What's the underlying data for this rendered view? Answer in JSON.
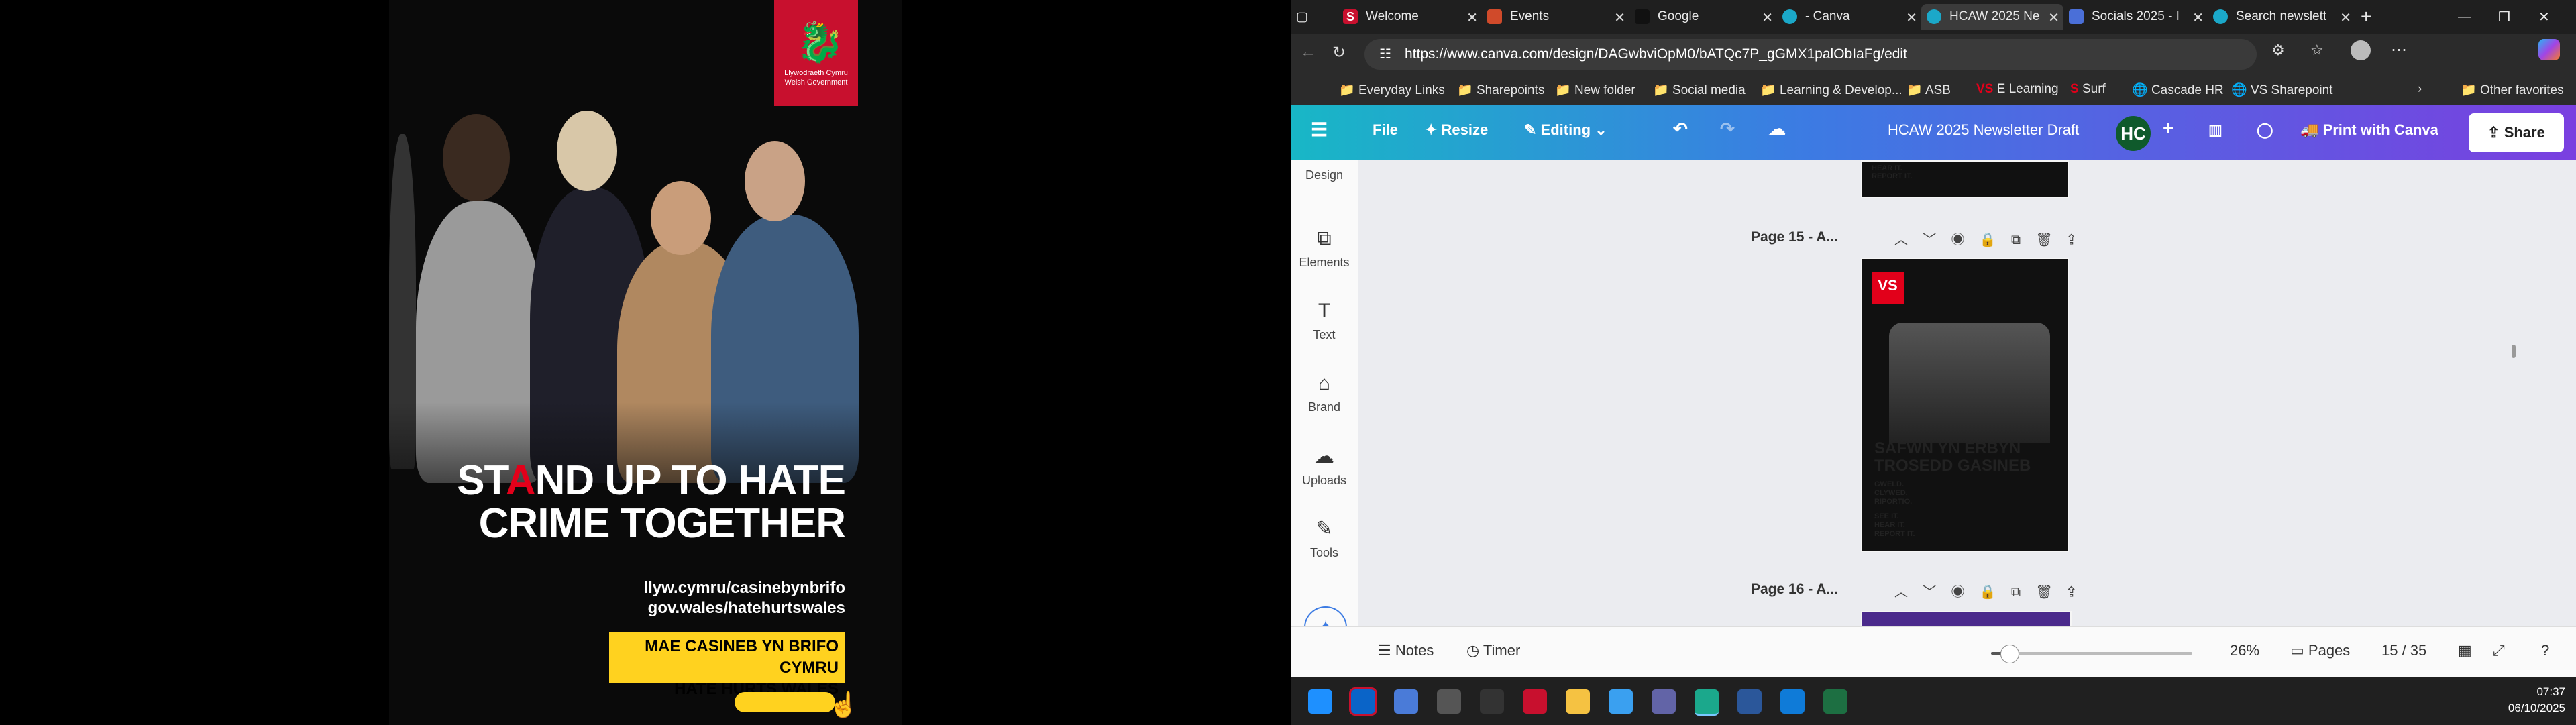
{
  "poster": {
    "logo_text": "Llywodraeth Cymru\nWelsh Government",
    "headline_line1_pre": "ST",
    "headline_line1_mark": "A",
    "headline_line1_post": "ND UP TO HATE",
    "headline_line2": "CRIME TOGETHER",
    "url1": "llyw.cymru/casinebynbrifo",
    "url2": "gov.wales/hatehurtswales",
    "yellow_line1": "MAE CASINEB YN BRIFO CYMRU",
    "yellow_line2": "HATE HURTS WALES"
  },
  "tabs": [
    {
      "label": "Welcome",
      "color": "#c8102e",
      "letter": "S"
    },
    {
      "label": "Events",
      "color": "#d04a2a",
      "letter": ""
    },
    {
      "label": "Google",
      "color": "#ffffff",
      "letter": "G"
    },
    {
      "label": "- Canva",
      "color": "#1ba8c9",
      "letter": "C"
    },
    {
      "label": "HCAW 2025 Ne",
      "color": "#1ba8c9",
      "letter": "C",
      "active": true
    },
    {
      "label": "Socials 2025 - I",
      "color": "#4a6fd8",
      "letter": ""
    },
    {
      "label": "Search newslett",
      "color": "#1ba8c9",
      "letter": "C"
    }
  ],
  "address": {
    "url": "https://www.canva.com/design/DAGwbviOpM0/bATQc7P_gGMX1palObIaFg/edit"
  },
  "bookmarks": [
    "Everyday Links",
    "Sharepoints",
    "New folder",
    "Social media",
    "Learning & Develop...",
    "ASB",
    "E Learning",
    "Surf",
    "Cascade HR",
    "VS Sharepoint",
    "Other favorites"
  ],
  "canva": {
    "file": "File",
    "resize": "Resize",
    "editing": "Editing",
    "title": "HCAW 2025 Newsletter Draft",
    "avatar": "HC",
    "print": "Print with Canva",
    "share": "Share"
  },
  "sidebar": [
    "Design",
    "Elements",
    "Text",
    "Brand",
    "Uploads",
    "Tools"
  ],
  "pages": {
    "p15": "Page 15 - A...",
    "p16": "Page 16 - A...",
    "thumb_head1": "SAFWN YN ERBYN",
    "thumb_head2": "TROSEDD GASINEB",
    "thumb_small": "GWELD.\nCLYWED.\nRIPORTIO.",
    "thumb_small2": "SEE IT.\nHEAR IT.\nREPORT IT.",
    "thumb_top": "HEAR IT.\nREPORT IT.",
    "vs": "VS"
  },
  "bottom": {
    "notes": "Notes",
    "timer": "Timer",
    "zoom": "26%",
    "pages_label": "Pages",
    "page_count": "15 / 35",
    "zoom_level": 0.26
  },
  "taskbar": {
    "time": "07:37",
    "date": "06/10/2025"
  }
}
